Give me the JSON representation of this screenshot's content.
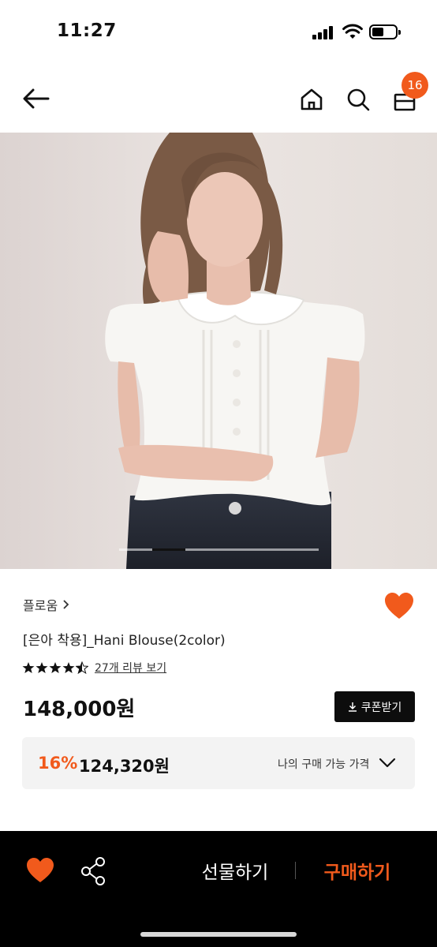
{
  "status_bar": {
    "time": "11:27"
  },
  "nav": {
    "cart_count": "16",
    "icons": [
      "arrow-left-icon",
      "home-icon",
      "search-icon",
      "shopping-bag-icon"
    ]
  },
  "gallery": {
    "slide_index": 2,
    "slide_count": 6
  },
  "product": {
    "brand": "플로움",
    "name": "[은아 착용]_Hani Blouse(2color)",
    "rating": 4.5,
    "review_link": "27개 리뷰 보기",
    "price": "148,000원",
    "coupon_label": "쿠폰받기"
  },
  "my_price": {
    "discount_rate": "16%",
    "discount_price": "124,320원",
    "label": "나의 구매 가능 가격"
  },
  "bottom_bar": {
    "gift_label": "선물하기",
    "buy_label": "구매하기"
  },
  "colors": {
    "accent": "#f15a1c",
    "dark_button": "#0d0d0d",
    "price_box_bg": "#f3f3f3"
  }
}
